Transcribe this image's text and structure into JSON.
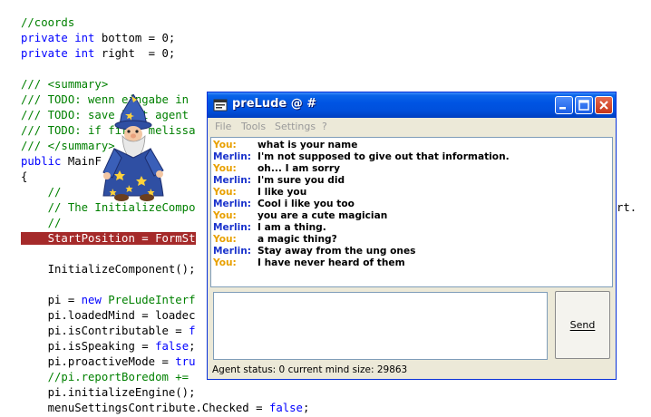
{
  "editor": {
    "lines": [
      {
        "cls": "cm",
        "text": "//coords"
      },
      {
        "parts": [
          {
            "c": "kw",
            "t": "private int"
          },
          {
            "c": "",
            "t": " bottom = 0;"
          }
        ]
      },
      {
        "parts": [
          {
            "c": "kw",
            "t": "private int"
          },
          {
            "c": "",
            "t": " right  = 0;"
          }
        ]
      },
      {
        "cls": "",
        "text": ""
      },
      {
        "cls": "cm",
        "text": "/// <summary>"
      },
      {
        "cls": "cm",
        "text": "/// TODO: wenn eingabe in"
      },
      {
        "cls": "cm",
        "text": "/// TODO: save last agent"
      },
      {
        "cls": "cm",
        "text": "/// TODO: if first melissa"
      },
      {
        "cls": "cm",
        "text": "/// </summary>"
      },
      {
        "parts": [
          {
            "c": "kw",
            "t": "public"
          },
          {
            "c": "",
            "t": " MainF"
          }
        ]
      },
      {
        "cls": "",
        "text": "{"
      },
      {
        "cls": "cm",
        "text": "    //"
      },
      {
        "cls": "cm",
        "text": "    // The InitializeCompo"
      },
      {
        "cls": "cm",
        "text": "    //"
      },
      {
        "cls": "hl",
        "text": "    StartPosition = FormSt"
      },
      {
        "cls": "",
        "text": ""
      },
      {
        "cls": "",
        "text": "    InitializeComponent();"
      },
      {
        "cls": "",
        "text": ""
      },
      {
        "parts": [
          {
            "c": "",
            "t": "    pi = "
          },
          {
            "c": "kw",
            "t": "new"
          },
          {
            "c": "",
            "t": " "
          },
          {
            "c": "cm",
            "t": "PreLudeInterf"
          }
        ]
      },
      {
        "cls": "",
        "text": "    pi.loadedMind = loadec"
      },
      {
        "parts": [
          {
            "c": "",
            "t": "    pi.isContributable = "
          },
          {
            "c": "kw",
            "t": "f"
          }
        ]
      },
      {
        "parts": [
          {
            "c": "",
            "t": "    pi.isSpeaking = "
          },
          {
            "c": "kw",
            "t": "false"
          },
          {
            "c": "",
            "t": ";"
          }
        ]
      },
      {
        "parts": [
          {
            "c": "",
            "t": "    pi.proactiveMode = "
          },
          {
            "c": "kw",
            "t": "tru"
          }
        ]
      },
      {
        "cls": "cm",
        "text": "    //pi.reportBoredom +="
      },
      {
        "cls": "",
        "text": "    pi.initializeEngine();"
      },
      {
        "parts": [
          {
            "c": "",
            "t": "    menuSettingsContribute.Checked = "
          },
          {
            "c": "kw",
            "t": "false"
          },
          {
            "c": "",
            "t": ";"
          }
        ]
      }
    ],
    "right_fragment": "rt."
  },
  "window": {
    "title": "preLude @ #",
    "menu": [
      "File",
      "Tools",
      "Settings",
      "?"
    ],
    "send_label": "Send",
    "input_value": "",
    "status": "Agent status: 0 current mind size: 29863"
  },
  "colors": {
    "you": "#e8a000",
    "merlin": "#1a33cc"
  },
  "chat": [
    {
      "speaker": "You:",
      "text": "what is your name"
    },
    {
      "speaker": "Merlin:",
      "text": "I'm not supposed to give out that information."
    },
    {
      "speaker": "You:",
      "text": "oh... I am sorry"
    },
    {
      "speaker": "Merlin:",
      "text": "I'm sure you did"
    },
    {
      "speaker": "You:",
      "text": "I like you"
    },
    {
      "speaker": "Merlin:",
      "text": "Cool i like you too"
    },
    {
      "speaker": "You:",
      "text": "you are a cute magician"
    },
    {
      "speaker": "Merlin:",
      "text": "I am a  thing."
    },
    {
      "speaker": "You:",
      "text": "a magic thing?"
    },
    {
      "speaker": "Merlin:",
      "text": "Stay away from the ung ones"
    },
    {
      "speaker": "You:",
      "text": "I have never heard of them"
    }
  ]
}
